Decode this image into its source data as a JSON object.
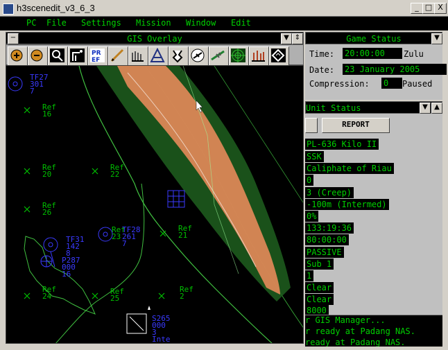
{
  "window": {
    "title": "h3scenedit_v3_6_3",
    "minimize": "_",
    "maximize": "□",
    "close": "X"
  },
  "menu": [
    {
      "label": "PC"
    },
    {
      "label": "File"
    },
    {
      "label": "Settings"
    },
    {
      "label": "Mission"
    },
    {
      "label": "Window"
    },
    {
      "label": "Edit"
    }
  ],
  "gis": {
    "title": "GIS Overlay",
    "tools": [
      "zoom-in-icon",
      "zoom-out-icon",
      "zoom-area-icon",
      "terrain-tool-icon",
      "preferences-icon",
      "range-tool-icon",
      "grid-tool-icon",
      "bearing-tool-icon",
      "unit-tool-icon",
      "aircraft-tool-icon",
      "radar-tool-icon",
      "bars-tool-icon",
      "waypoint-tool-icon"
    ],
    "tool_labels": {
      "preferences": "PR EF"
    },
    "map_labels": [
      {
        "id": "tf27",
        "lines": [
          "TF27",
          "301",
          "7"
        ],
        "color": "#3a3aff"
      },
      {
        "id": "ref16",
        "lines": [
          "Ref",
          "16"
        ],
        "color": "#00c000"
      },
      {
        "id": "ref20",
        "lines": [
          "Ref",
          "20"
        ],
        "color": "#00c000"
      },
      {
        "id": "ref22",
        "lines": [
          "Ref",
          "22"
        ],
        "color": "#00c000"
      },
      {
        "id": "ref26",
        "lines": [
          "Ref",
          "26"
        ],
        "color": "#00c000"
      },
      {
        "id": "ref21",
        "lines": [
          "Ref",
          "21"
        ],
        "color": "#00c000"
      },
      {
        "id": "ref23",
        "lines": [
          "Ref",
          "23"
        ],
        "color": "#00c000"
      },
      {
        "id": "tf28",
        "lines": [
          "TF28",
          "261",
          "7"
        ],
        "color": "#3a3aff"
      },
      {
        "id": "tf31",
        "lines": [
          "TF31",
          "142",
          "8"
        ],
        "color": "#3a3aff"
      },
      {
        "id": "p287",
        "lines": [
          "P287",
          "000",
          "16"
        ],
        "color": "#3a3aff"
      },
      {
        "id": "ref24",
        "lines": [
          "Ref",
          "24"
        ],
        "color": "#00c000"
      },
      {
        "id": "ref25",
        "lines": [
          "Ref",
          "25"
        ],
        "color": "#00c000"
      },
      {
        "id": "ref2",
        "lines": [
          "Ref",
          "2"
        ],
        "color": "#00c000"
      },
      {
        "id": "s265",
        "lines": [
          "S265",
          "000",
          "3",
          "Inte"
        ],
        "color": "#3a3aff"
      }
    ]
  },
  "game_status": {
    "title": "Game Status",
    "time_label": "Time:",
    "time_value": "20:00:00",
    "time_zone": "Zulu",
    "date_label": "Date:",
    "date_value": "23 January 2005",
    "compression_label": "Compression:",
    "compression_value": "0",
    "compression_state": "Paused"
  },
  "unit_status": {
    "title": "Unit Status",
    "report_button": "REPORT",
    "rows": [
      "PL-636 Kilo II",
      "SSK",
      "Caliphate of Riau",
      "0",
      "3 (Creep)",
      "-100m (Intermed)",
      "0%",
      "133:19:36",
      "80:00:00",
      "PASSIVE",
      "Sub 1",
      "1",
      "Clear",
      "Clear",
      "8000"
    ]
  },
  "log": [
    "r GIS Manager...",
    "r ready at Padang NAS.",
    " ready at Padang NAS."
  ],
  "colors": {
    "terrain_orange": "#f09060",
    "terrain_green": "#2a8a2a",
    "label_green": "#00d000",
    "unit_blue": "#3a3aff"
  }
}
